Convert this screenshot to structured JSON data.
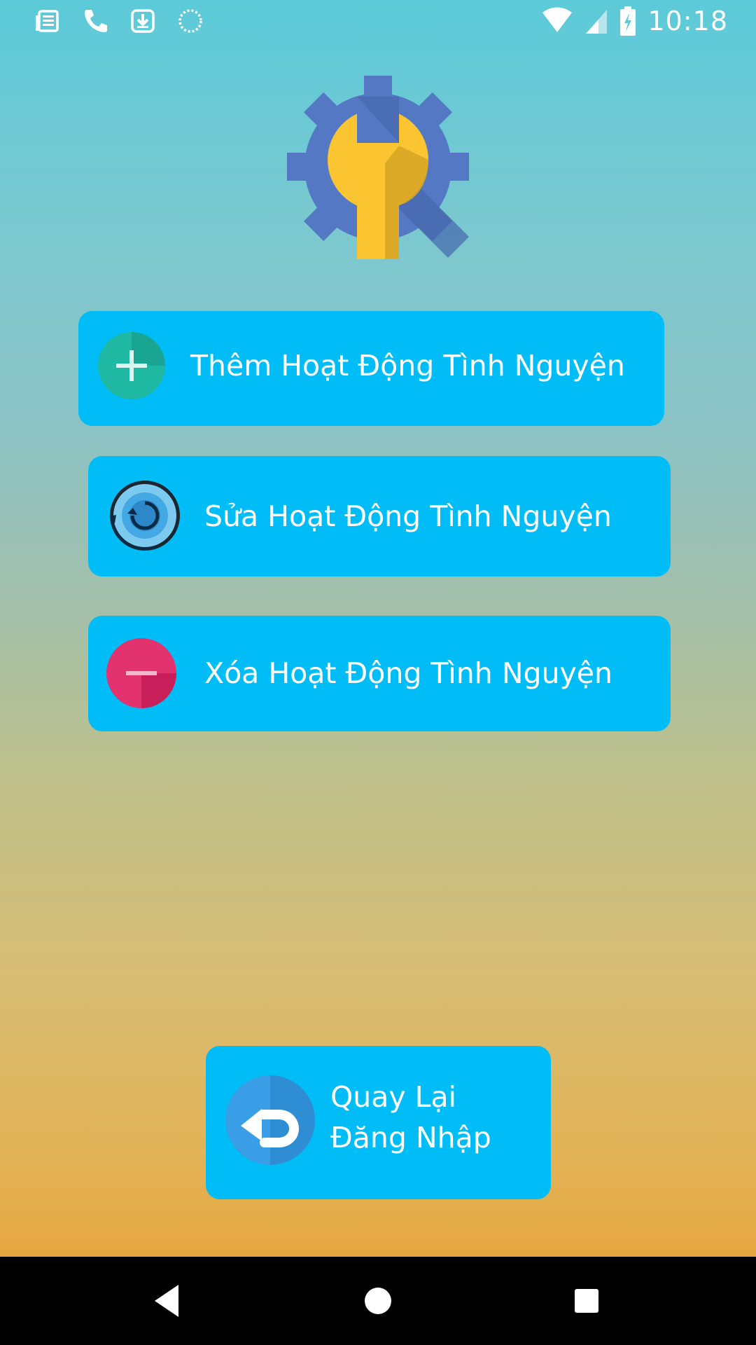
{
  "status_bar": {
    "time": "10:18",
    "icons": [
      "news-icon",
      "phone-icon",
      "download-icon",
      "sync-icon",
      "wifi-icon",
      "signal-icon",
      "battery-charging-icon"
    ]
  },
  "logo": {
    "icon": "gear-wrench-icon",
    "colors": {
      "gear": "#5478c4",
      "gear_shadow": "#4566ad",
      "wrench": "#fbc531",
      "wrench_shadow": "#d7a526"
    }
  },
  "actions": {
    "add": {
      "label": "Thêm Hoạt Động Tình Nguyện",
      "icon": "plus-circle-icon",
      "icon_color": "#1fb8a3"
    },
    "edit": {
      "label": "Sửa Hoạt Động Tình Nguyện",
      "icon": "refresh-circle-icon",
      "icon_color": "#43a8e4"
    },
    "delete": {
      "label": "Xóa Hoạt Động Tình Nguyện",
      "icon": "minus-circle-icon",
      "icon_color": "#e2336f"
    }
  },
  "back": {
    "line1": "Quay Lại",
    "line2": "Đăng Nhập",
    "icon": "return-arrow-icon",
    "icon_color": "#3a9ee6"
  },
  "colors": {
    "button_bg": "#00bdf7",
    "text": "#ffffff",
    "nav_bg": "#000000"
  },
  "nav_bar": {
    "buttons": [
      "back-triangle-icon",
      "home-circle-icon",
      "recents-square-icon"
    ]
  }
}
